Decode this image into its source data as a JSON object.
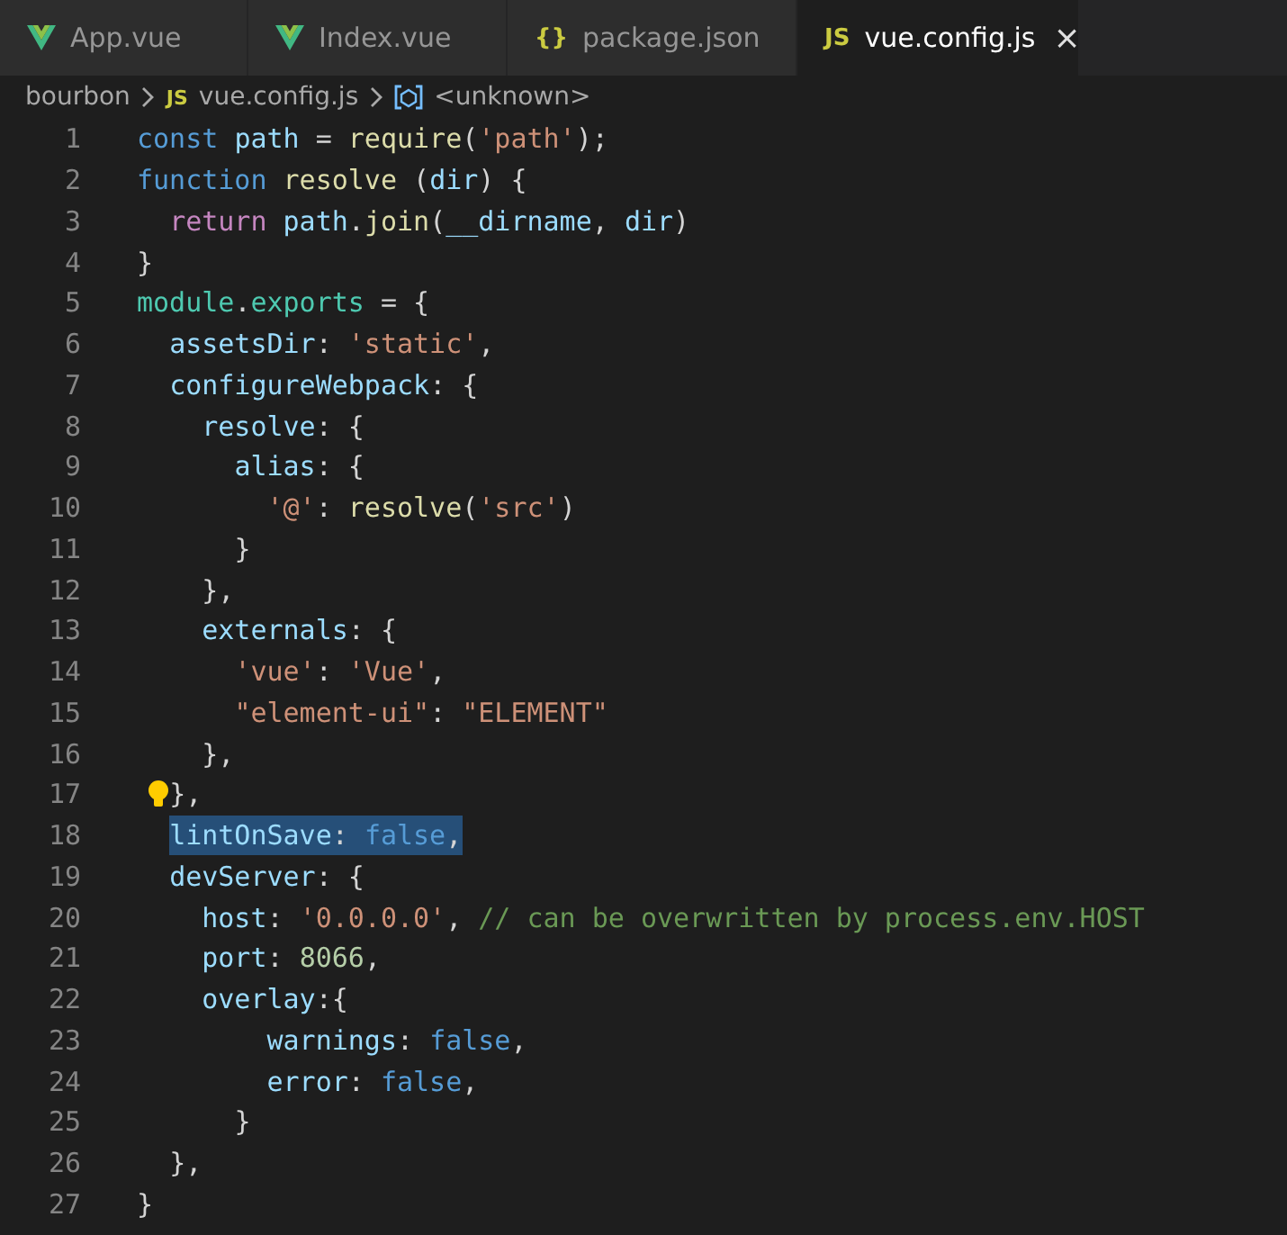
{
  "tabs": [
    {
      "label": "App.vue",
      "selected": false,
      "kind": "vue"
    },
    {
      "label": "Index.vue",
      "selected": false,
      "kind": "vue"
    },
    {
      "label": "package.json",
      "selected": false,
      "kind": "glyph",
      "glyph": "{}"
    },
    {
      "label": "vue.config.js",
      "selected": true,
      "kind": "glyph",
      "glyph": "JS",
      "close": "×"
    }
  ],
  "breadcrumb": [
    {
      "label": "bourbon",
      "kind": "folder"
    },
    {
      "label": "vue.config.js",
      "kind": "file",
      "glyph": "JS"
    },
    {
      "label": "<unknown>",
      "kind": "symbol"
    }
  ],
  "lines": [
    {
      "number": "1",
      "selected": false,
      "tokens": [
        {
          "text": "const ",
          "kind": "keyword"
        },
        {
          "text": "path",
          "kind": "variable"
        },
        {
          "text": " = ",
          "kind": "plain"
        },
        {
          "text": "require",
          "kind": "function"
        },
        {
          "text": "(",
          "kind": "plain"
        },
        {
          "text": "'path'",
          "kind": "string"
        },
        {
          "text": ");",
          "kind": "plain"
        }
      ]
    },
    {
      "number": "2",
      "selected": false,
      "tokens": [
        {
          "text": "function ",
          "kind": "keyword"
        },
        {
          "text": "resolve",
          "kind": "function"
        },
        {
          "text": " (",
          "kind": "plain"
        },
        {
          "text": "dir",
          "kind": "variable"
        },
        {
          "text": ") {",
          "kind": "plain"
        }
      ]
    },
    {
      "number": "3",
      "selected": false,
      "tokens": [
        {
          "text": "  return ",
          "kind": "control"
        },
        {
          "text": "path",
          "kind": "variable"
        },
        {
          "text": ".",
          "kind": "plain"
        },
        {
          "text": "join",
          "kind": "function"
        },
        {
          "text": "(",
          "kind": "plain"
        },
        {
          "text": "__dirname",
          "kind": "variable"
        },
        {
          "text": ", ",
          "kind": "plain"
        },
        {
          "text": "dir",
          "kind": "variable"
        },
        {
          "text": ")",
          "kind": "plain"
        }
      ]
    },
    {
      "number": "4",
      "selected": false,
      "tokens": [
        {
          "text": "}",
          "kind": "plain"
        }
      ]
    },
    {
      "number": "5",
      "selected": false,
      "tokens": [
        {
          "text": "module",
          "kind": "module"
        },
        {
          "text": ".",
          "kind": "plain"
        },
        {
          "text": "exports",
          "kind": "module"
        },
        {
          "text": " = {",
          "kind": "plain"
        }
      ]
    },
    {
      "number": "6",
      "selected": false,
      "tokens": [
        {
          "text": "  assetsDir",
          "kind": "variable"
        },
        {
          "text": ": ",
          "kind": "plain"
        },
        {
          "text": "'static'",
          "kind": "string"
        },
        {
          "text": ",",
          "kind": "plain"
        }
      ]
    },
    {
      "number": "7",
      "selected": false,
      "tokens": [
        {
          "text": "  configureWebpack",
          "kind": "variable"
        },
        {
          "text": ": {",
          "kind": "plain"
        }
      ]
    },
    {
      "number": "8",
      "selected": false,
      "tokens": [
        {
          "text": "    resolve",
          "kind": "variable"
        },
        {
          "text": ": {",
          "kind": "plain"
        }
      ]
    },
    {
      "number": "9",
      "selected": false,
      "tokens": [
        {
          "text": "      alias",
          "kind": "variable"
        },
        {
          "text": ": {",
          "kind": "plain"
        }
      ]
    },
    {
      "number": "10",
      "selected": false,
      "tokens": [
        {
          "text": "        '@'",
          "kind": "string"
        },
        {
          "text": ": ",
          "kind": "plain"
        },
        {
          "text": "resolve",
          "kind": "function"
        },
        {
          "text": "(",
          "kind": "plain"
        },
        {
          "text": "'src'",
          "kind": "string"
        },
        {
          "text": ")",
          "kind": "plain"
        }
      ]
    },
    {
      "number": "11",
      "selected": false,
      "tokens": [
        {
          "text": "      }",
          "kind": "plain"
        }
      ]
    },
    {
      "number": "12",
      "selected": false,
      "tokens": [
        {
          "text": "    },",
          "kind": "plain"
        }
      ]
    },
    {
      "number": "13",
      "selected": false,
      "tokens": [
        {
          "text": "    externals",
          "kind": "variable"
        },
        {
          "text": ": {",
          "kind": "plain"
        }
      ]
    },
    {
      "number": "14",
      "selected": false,
      "tokens": [
        {
          "text": "      'vue'",
          "kind": "string"
        },
        {
          "text": ": ",
          "kind": "plain"
        },
        {
          "text": "'Vue'",
          "kind": "string"
        },
        {
          "text": ",",
          "kind": "plain"
        }
      ]
    },
    {
      "number": "15",
      "selected": false,
      "tokens": [
        {
          "text": "      \"element-ui\"",
          "kind": "string"
        },
        {
          "text": ": ",
          "kind": "plain"
        },
        {
          "text": "\"ELEMENT\"",
          "kind": "string"
        }
      ]
    },
    {
      "number": "16",
      "selected": false,
      "tokens": [
        {
          "text": "    },",
          "kind": "plain"
        }
      ]
    },
    {
      "number": "17",
      "selected": false,
      "lightbulb": true,
      "tokens": [
        {
          "text": "  },",
          "kind": "plain"
        }
      ]
    },
    {
      "number": "18",
      "selected": true,
      "tokens": [
        {
          "text": "  lintOnSave",
          "kind": "variable"
        },
        {
          "text": ": ",
          "kind": "plain"
        },
        {
          "text": "false",
          "kind": "keyword"
        },
        {
          "text": ",",
          "kind": "plain"
        }
      ]
    },
    {
      "number": "19",
      "selected": false,
      "tokens": [
        {
          "text": "  devServer",
          "kind": "variable"
        },
        {
          "text": ": {",
          "kind": "plain"
        }
      ]
    },
    {
      "number": "20",
      "selected": false,
      "tokens": [
        {
          "text": "    host",
          "kind": "variable"
        },
        {
          "text": ": ",
          "kind": "plain"
        },
        {
          "text": "'0.0.0.0'",
          "kind": "string"
        },
        {
          "text": ", ",
          "kind": "plain"
        },
        {
          "text": "// can be overwritten by process.env.HOST",
          "kind": "comment"
        }
      ]
    },
    {
      "number": "21",
      "selected": false,
      "tokens": [
        {
          "text": "    port",
          "kind": "variable"
        },
        {
          "text": ": ",
          "kind": "plain"
        },
        {
          "text": "8066",
          "kind": "number"
        },
        {
          "text": ",",
          "kind": "plain"
        }
      ]
    },
    {
      "number": "22",
      "selected": false,
      "tokens": [
        {
          "text": "    overlay",
          "kind": "variable"
        },
        {
          "text": ":{",
          "kind": "plain"
        }
      ]
    },
    {
      "number": "23",
      "selected": false,
      "tokens": [
        {
          "text": "        warnings",
          "kind": "variable"
        },
        {
          "text": ": ",
          "kind": "plain"
        },
        {
          "text": "false",
          "kind": "keyword"
        },
        {
          "text": ",",
          "kind": "plain"
        }
      ]
    },
    {
      "number": "24",
      "selected": false,
      "tokens": [
        {
          "text": "        error",
          "kind": "variable"
        },
        {
          "text": ": ",
          "kind": "plain"
        },
        {
          "text": "false",
          "kind": "keyword"
        },
        {
          "text": ",",
          "kind": "plain"
        }
      ]
    },
    {
      "number": "25",
      "selected": false,
      "tokens": [
        {
          "text": "      }",
          "kind": "plain"
        }
      ]
    },
    {
      "number": "26",
      "selected": false,
      "tokens": [
        {
          "text": "  },",
          "kind": "plain"
        }
      ]
    },
    {
      "number": "27",
      "selected": false,
      "tokens": [
        {
          "text": "}",
          "kind": "plain"
        }
      ]
    }
  ]
}
